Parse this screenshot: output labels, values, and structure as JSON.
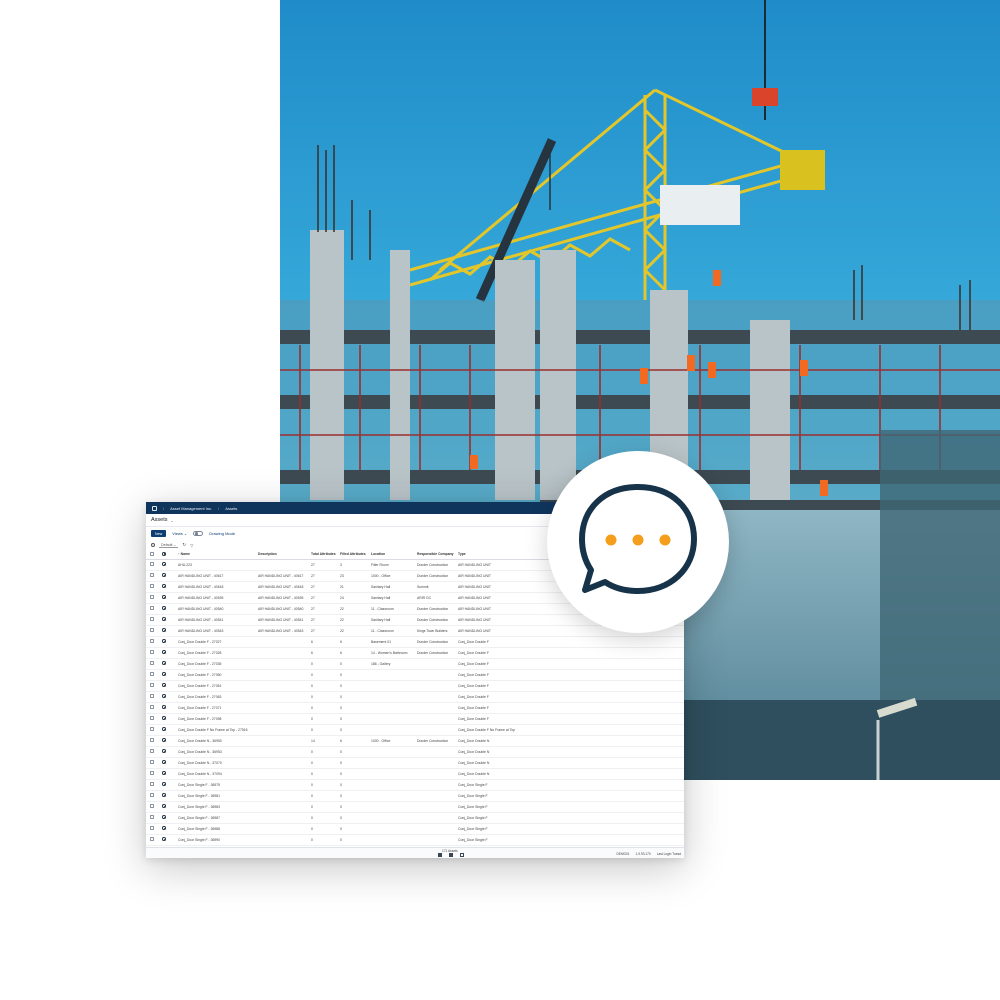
{
  "app": {
    "breadcrumb": [
      "Asset Management Inc.",
      "Assets"
    ],
    "page_title": "Assets",
    "toolbar": {
      "new_label": "New",
      "views_label": "Views",
      "drawing_mode_label": "Drawing Mode"
    },
    "filter": {
      "default_label": "Default"
    },
    "table": {
      "columns": [
        "Name",
        "Description",
        "Total Attributes",
        "Filled Attributes",
        "Location",
        "Responsible Company",
        "Type"
      ],
      "rows": [
        [
          "AHU-223",
          "",
          "27",
          "3",
          "Filter Room",
          "Dunder Construction",
          "AIR HANDLING UNIT"
        ],
        [
          "AIR HANDLING UNIT - 40617",
          "AIR HANDLING UNIT - 40617",
          "27",
          "23",
          "1000 - Office",
          "Dunder Construction",
          "AIR HANDLING UNIT"
        ],
        [
          "AIR HANDLING UNIT - 40618",
          "AIR HANDLING UNIT - 40618",
          "27",
          "21",
          "Sanitary Hall",
          "Summit",
          "AIR HANDLING UNIT"
        ],
        [
          "AIR HANDLING UNIT - 40539",
          "AIR HANDLING UNIT - 40539",
          "27",
          "24",
          "Sanitary Hall",
          "ARIR GC",
          "AIR HANDLING UNIT"
        ],
        [
          "AIR HANDLING UNIT - 40540",
          "AIR HANDLING UNIT - 40540",
          "27",
          "22",
          "11 - Classroom",
          "Dunder Construction",
          "AIR HANDLING UNIT"
        ],
        [
          "AIR HANDLING UNIT - 40541",
          "AIR HANDLING UNIT - 40541",
          "27",
          "22",
          "Sanitary Hall",
          "Dunder Construction",
          "AIR HANDLING UNIT"
        ],
        [
          "AIR HANDLING UNIT - 40543",
          "AIR HANDLING UNIT - 40543",
          "27",
          "22",
          "11 - Classroom",
          "Kings Town Builders",
          "AIR HANDLING UNIT"
        ],
        [
          "Conj_Door Double F - 27027",
          "",
          "6",
          "6",
          "Basement 01",
          "Dunder Construction",
          "Conj_Door Double F"
        ],
        [
          "Conj_Door Double F - 27028",
          "",
          "6",
          "6",
          "14 - Women's Bathroom",
          "Dunder Construction",
          "Conj_Door Double F"
        ],
        [
          "Conj_Door Double F - 27035",
          "",
          "0",
          "0",
          "186 - Gallery",
          "",
          "Conj_Door Double F"
        ],
        [
          "Conj_Door Double F - 27050",
          "",
          "0",
          "0",
          "",
          "",
          "Conj_Door Double F"
        ],
        [
          "Conj_Door Double F - 27051",
          "",
          "0",
          "0",
          "",
          "",
          "Conj_Door Double F"
        ],
        [
          "Conj_Door Double F - 27063",
          "",
          "0",
          "0",
          "",
          "",
          "Conj_Door Double F"
        ],
        [
          "Conj_Door Double F - 27071",
          "",
          "0",
          "0",
          "",
          "",
          "Conj_Door Double F"
        ],
        [
          "Conj_Door Double F - 27098",
          "",
          "0",
          "0",
          "",
          "",
          "Conj_Door Double F"
        ],
        [
          "Conj_Door Double F No Frame at Top - 27516",
          "",
          "0",
          "0",
          "",
          "",
          "Conj_Door Double F No Frame at Top"
        ],
        [
          "Conj_Door Double N - 36950",
          "",
          "14",
          "6",
          "1000 - Office",
          "Dunder Construction",
          "Conj_Door Double N"
        ],
        [
          "Conj_Door Double N - 36953",
          "",
          "0",
          "0",
          "",
          "",
          "Conj_Door Double N"
        ],
        [
          "Conj_Door Double N - 37070",
          "",
          "0",
          "0",
          "",
          "",
          "Conj_Door Double N"
        ],
        [
          "Conj_Door Double N - 37094",
          "",
          "0",
          "0",
          "",
          "",
          "Conj_Door Double N"
        ],
        [
          "Conj_Door Single F - 36975",
          "",
          "0",
          "0",
          "",
          "",
          "Conj_Door Single F"
        ],
        [
          "Conj_Door Single F - 36981",
          "",
          "0",
          "0",
          "",
          "",
          "Conj_Door Single F"
        ],
        [
          "Conj_Door Single F - 36983",
          "",
          "0",
          "0",
          "",
          "",
          "Conj_Door Single F"
        ],
        [
          "Conj_Door Single F - 36987",
          "",
          "0",
          "0",
          "",
          "",
          "Conj_Door Single F"
        ],
        [
          "Conj_Door Single F - 36988",
          "",
          "0",
          "0",
          "",
          "",
          "Conj_Door Single F"
        ],
        [
          "Conj_Door Single F - 36990",
          "",
          "0",
          "0",
          "",
          "",
          "Conj_Door Single F"
        ]
      ]
    },
    "statusbar": {
      "count": "171 Assets",
      "version": "DEMO01",
      "build": "1.9.93.170",
      "last_login": "Last Login Tuesd"
    }
  },
  "colors": {
    "navy": "#10355d",
    "accent_orange": "#f59e1b",
    "bubble_stroke": "#163349",
    "sky": "#2fa7d8"
  },
  "icons": [
    "home-icon",
    "chevron-down-icon",
    "search-icon",
    "refresh-icon",
    "filter-icon",
    "globe-icon",
    "chat-bubble-icon"
  ]
}
